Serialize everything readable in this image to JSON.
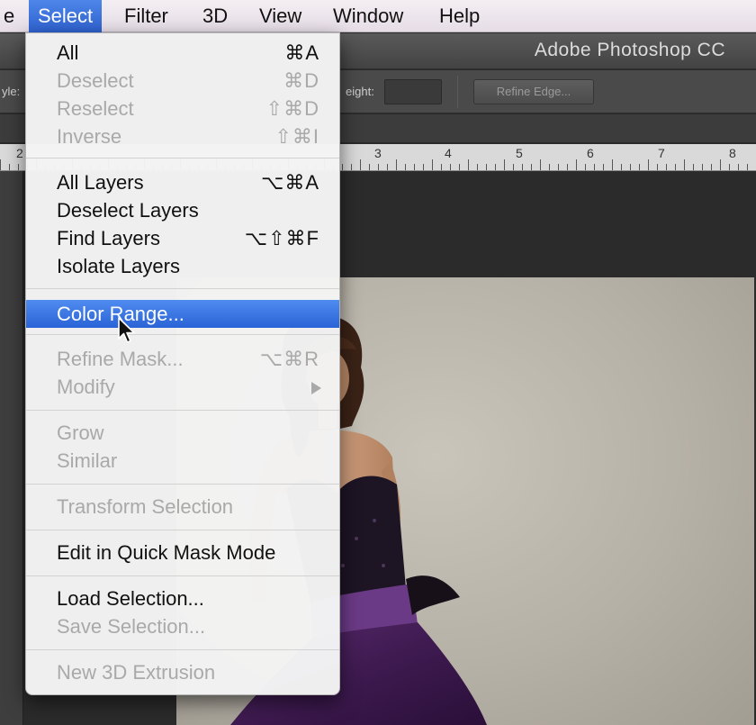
{
  "menubar": {
    "items": [
      "e",
      "Select",
      "Filter",
      "3D",
      "View",
      "Window",
      "Help"
    ],
    "active": "Select"
  },
  "app": {
    "title": "Adobe Photoshop CC"
  },
  "options": {
    "style_label": "yle:",
    "height_label": "eight:",
    "refine_edge_label": "Refine Edge..."
  },
  "ruler": {
    "numbers": [
      "2",
      "3",
      "4",
      "5",
      "6",
      "7",
      "8"
    ]
  },
  "select_menu": {
    "items": [
      {
        "label": "All",
        "shortcut": "⌘A",
        "enabled": true
      },
      {
        "label": "Deselect",
        "shortcut": "⌘D",
        "enabled": false
      },
      {
        "label": "Reselect",
        "shortcut": "⇧⌘D",
        "enabled": false
      },
      {
        "label": "Inverse",
        "shortcut": "⇧⌘I",
        "enabled": false
      },
      {
        "label": "All Layers",
        "shortcut": "⌥⌘A",
        "enabled": true
      },
      {
        "label": "Deselect Layers",
        "shortcut": "",
        "enabled": true
      },
      {
        "label": "Find Layers",
        "shortcut": "⌥⇧⌘F",
        "enabled": true
      },
      {
        "label": "Isolate Layers",
        "shortcut": "",
        "enabled": true
      },
      {
        "label": "Color Range...",
        "shortcut": "",
        "enabled": true,
        "highlighted": true
      },
      {
        "label": "Refine Mask...",
        "shortcut": "⌥⌘R",
        "enabled": false
      },
      {
        "label": "Modify",
        "shortcut": "",
        "enabled": false,
        "submenu": true
      },
      {
        "label": "Grow",
        "shortcut": "",
        "enabled": false
      },
      {
        "label": "Similar",
        "shortcut": "",
        "enabled": false
      },
      {
        "label": "Transform Selection",
        "shortcut": "",
        "enabled": false
      },
      {
        "label": "Edit in Quick Mask Mode",
        "shortcut": "",
        "enabled": true
      },
      {
        "label": "Load Selection...",
        "shortcut": "",
        "enabled": true
      },
      {
        "label": "Save Selection...",
        "shortcut": "",
        "enabled": false
      },
      {
        "label": "New 3D Extrusion",
        "shortcut": "",
        "enabled": false
      }
    ]
  },
  "colors": {
    "menu_highlight": "#3474e0",
    "disabled_text": "#a9a9a9",
    "dress": "#3d1a48"
  }
}
